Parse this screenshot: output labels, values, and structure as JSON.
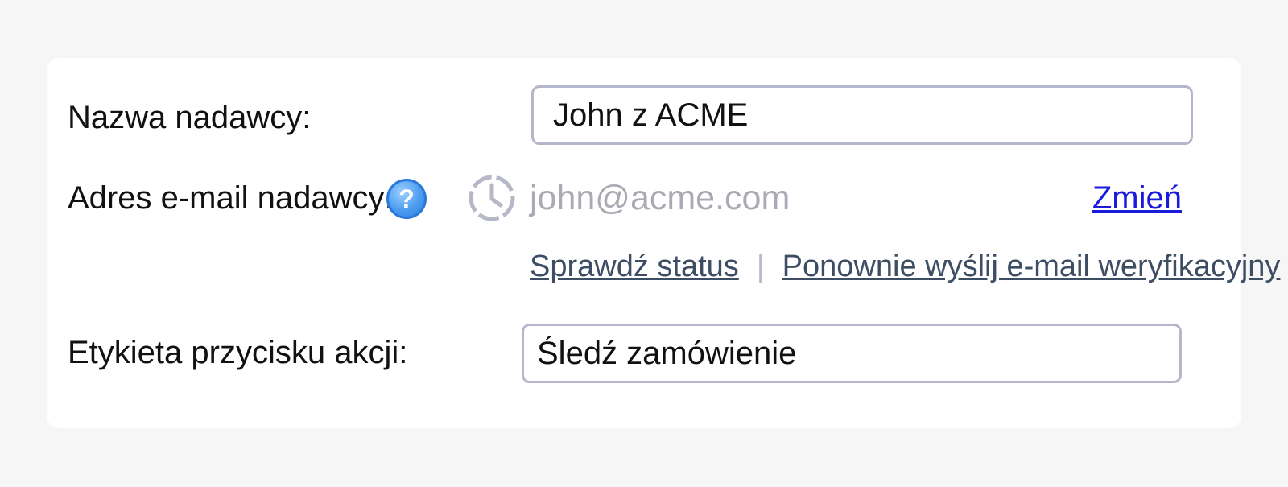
{
  "form": {
    "sender_name": {
      "label": "Nazwa nadawcy:",
      "value": "John z ACME"
    },
    "sender_email": {
      "label": "Adres e-mail nadawcy:",
      "help_symbol": "?",
      "status_icon": "clock-icon",
      "value": "john@acme.com",
      "change_label": "Zmień",
      "check_status_label": "Sprawdź status",
      "separator": "|",
      "resend_label": "Ponownie wyślij e-mail weryfikacyjny"
    },
    "action_button_label": {
      "label": "Etykieta przycisku akcji:",
      "value": "Śledź zamówienie"
    }
  },
  "colors": {
    "link": "#1a1adc",
    "secondary_link": "#3d4d63",
    "input_border": "#b4b6cc",
    "placeholder_gray": "#a9aab3",
    "help_blue": "#4c9cf0"
  }
}
